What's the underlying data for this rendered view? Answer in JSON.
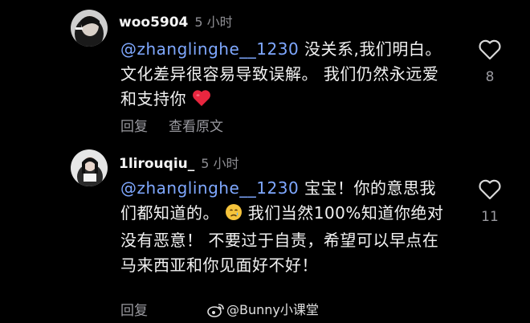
{
  "comments": [
    {
      "username": "woo5904",
      "time": "5 小时",
      "mention": "@zhanglinghe__1230",
      "text": " 没关系,我们明白。 文化差异很容易导致误解。 我们仍然永远爱和支持你",
      "actions": [
        "回复",
        "查看原文"
      ],
      "likes": "8"
    },
    {
      "username": "1lirouqiu_",
      "time": "5 小时",
      "mention": "@zhanglinghe__1230",
      "text": " 宝宝！你的意思我们都知道的。",
      "text_after_emoji": "我们当然100%知道你绝对没有恶意！ 不要过于自责，希望可以早点在马来西亚和你见面好不好！",
      "actions": [
        "回复"
      ],
      "likes": "11"
    }
  ],
  "watermark": {
    "text": "@Bunny小课堂",
    "icon": "weibo-icon"
  },
  "icons": {
    "heart_emoji": "heart-emoji-icon",
    "crying_emoji": "crying-emoji-icon",
    "like": "heart-outline-icon"
  },
  "colors": {
    "background": "#000000",
    "mention": "#7fa8ff",
    "secondary_text": "#9a9aa0",
    "heart_emoji": "#e8263f"
  }
}
